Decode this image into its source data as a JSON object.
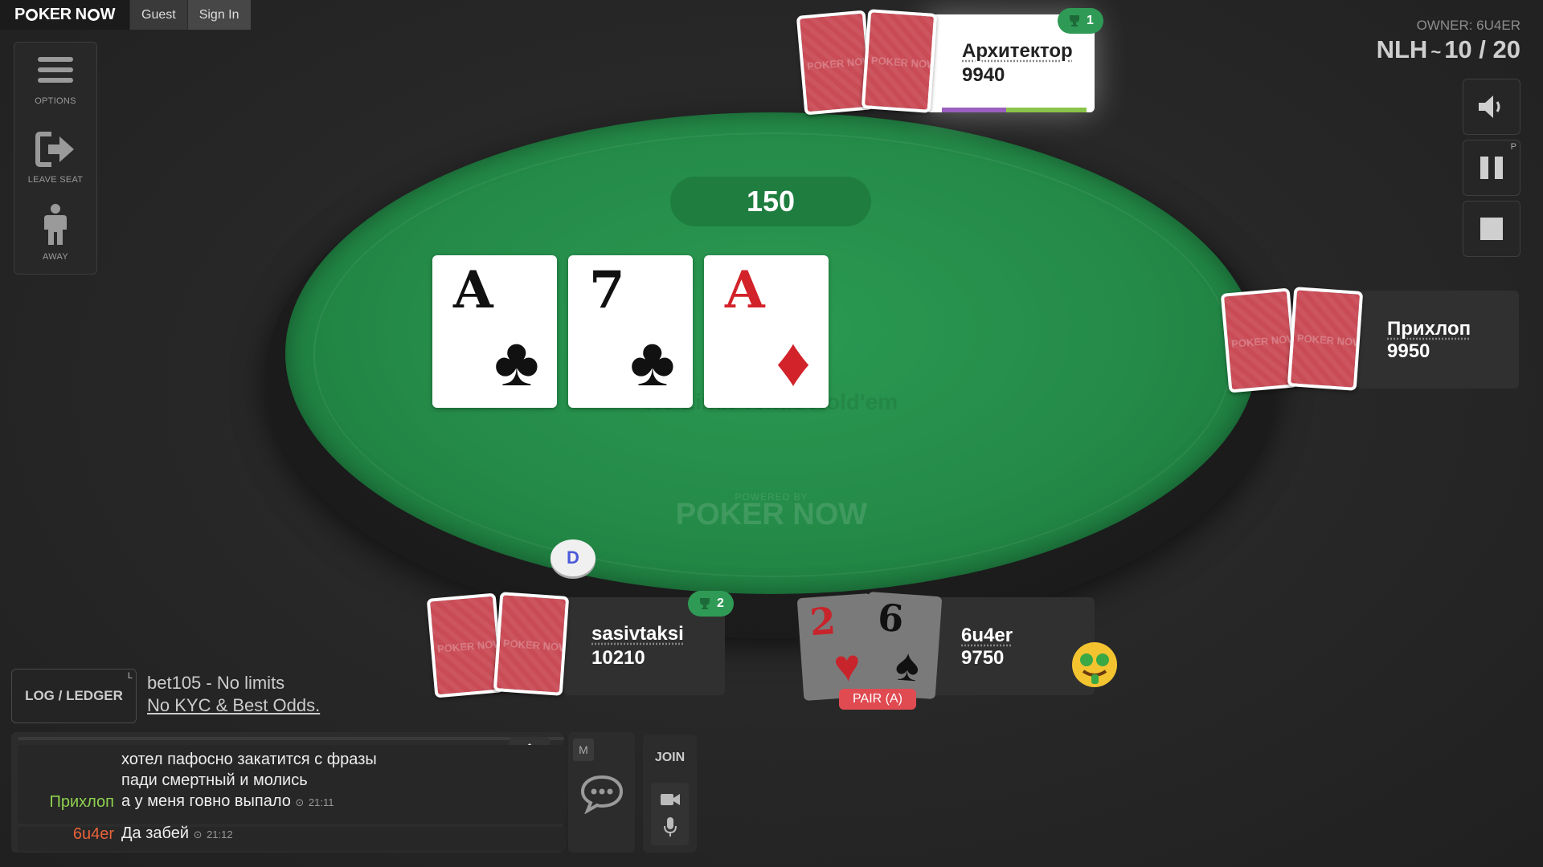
{
  "topbar": {
    "logo": "POKER NOW",
    "guest_label": "Guest",
    "signin_label": "Sign In"
  },
  "leftmenu": {
    "options_label": "OPTIONS",
    "leave_seat_label": "LEAVE SEAT",
    "away_label": "AWAY"
  },
  "header": {
    "owner": "OWNER: 6U4ER",
    "game_type": "NLH",
    "separator": "~",
    "blinds": "10 / 20"
  },
  "right_buttons": {
    "sound_icon": "speaker-icon",
    "pause_icon": "pause-icon",
    "pause_key": "P",
    "stop_icon": "stop-icon"
  },
  "table": {
    "pot": "150",
    "watermark": "No Limit Texas Hold'em",
    "powered_by": "POWERED BY",
    "brand": "POKER NOW",
    "board": [
      {
        "rank": "A",
        "suit": "♣",
        "color": "#111111"
      },
      {
        "rank": "7",
        "suit": "♣",
        "color": "#111111"
      },
      {
        "rank": "A",
        "suit": "♦",
        "color": "#d2232a"
      }
    ],
    "dealer_button": "D"
  },
  "players": {
    "top": {
      "name": "Архитектор",
      "stack": "9940",
      "trophies": "1",
      "card_back_text": "POKER NOW"
    },
    "right": {
      "name": "Прихлоп",
      "stack": "9950",
      "card_back_text": "POKER NOW"
    },
    "bottom_left": {
      "name": "sasivtaksi",
      "stack": "10210",
      "trophies": "2",
      "card_back_text": "POKER NOW"
    },
    "bottom_hero": {
      "name": "6u4er",
      "stack": "9750",
      "cards": [
        {
          "rank": "2",
          "suit": "♥",
          "color": "#c8242b"
        },
        {
          "rank": "6",
          "suit": "♠",
          "color": "#111111"
        }
      ],
      "hand_label": "PAIR (A)",
      "emoji": "money-mouth-face-icon"
    }
  },
  "log": {
    "label": "LOG / LEDGER",
    "shortcut": "L"
  },
  "promo": {
    "line1": "bet105 - No limits",
    "line2": "No KYC & Best Odds."
  },
  "chat": {
    "toggle_key": "M",
    "messages": [
      {
        "author": "",
        "text": "хотел пафосно закатится с фразы",
        "time": ""
      },
      {
        "author": "",
        "text": "пади смертный и молись",
        "time": ""
      },
      {
        "author": "Прихлоп",
        "author_color": "#8fd14f",
        "text": "а у меня говно выпало",
        "time": "21:11"
      },
      {
        "author": "6u4er",
        "author_color": "#e8623a",
        "text": "Да забей",
        "time": "21:12"
      }
    ]
  },
  "join": {
    "label": "JOIN"
  }
}
